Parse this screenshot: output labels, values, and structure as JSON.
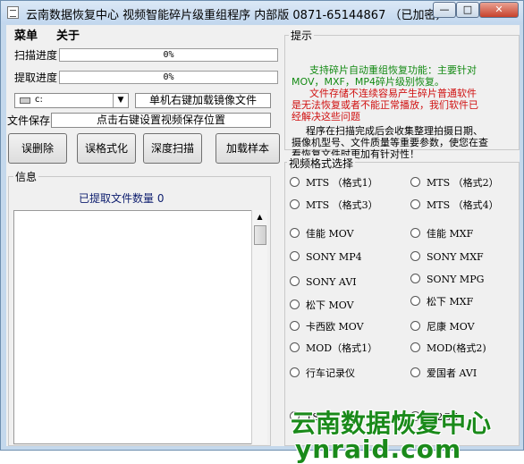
{
  "window": {
    "title": "云南数据恢复中心 视频智能碎片级重组程序 内部版 0871-65144867 （已加密）",
    "controls": {
      "min": "—",
      "max": "□",
      "close": "✕"
    }
  },
  "menu": {
    "items": [
      "菜单",
      "关于"
    ]
  },
  "scan_progress": {
    "label": "扫描进度",
    "value": 0,
    "text": "0%"
  },
  "extract_progress": {
    "label": "提取进度",
    "value": 0,
    "text": "0%"
  },
  "drive_select": {
    "value": "c:"
  },
  "mirror_field": {
    "value": "单机右键加载镜像文件"
  },
  "save_field": {
    "label": "文件保存",
    "value": "点击右键设置视频保存位置"
  },
  "actions": [
    "误删除",
    "误格式化",
    "深度扫描",
    "加载样本"
  ],
  "info": {
    "title": "信息",
    "count_label": "已提取文件数量 0"
  },
  "hint": {
    "title": "提示",
    "line1": "支持碎片自动重组恢复功能：主要针对",
    "line2": "MOV，MXF，MP4碎片级别恢复。",
    "line3": "文件存储不连续容易产生碎片普通软件",
    "line4": "是无法恢复或者不能正常播放，我们软件已",
    "line5": "经解决这些问题",
    "line6": "程序在扫描完成后会收集整理拍摄日期、",
    "line7": "摄像机型号、文件质量等重要参数，使您在查",
    "line8": "看恢复文件时更加有针对性！"
  },
  "formats": {
    "title": "视频格式选择",
    "options": [
      "MTS （格式1）",
      "MTS （格式2）",
      "MTS （格式3）",
      "MTS （格式4）",
      "佳能 MOV",
      "佳能 MXF",
      "SONY MP4",
      "SONY MXF",
      "SONY AVI",
      "SONY MPG",
      "松下 MOV",
      "松下 MXF",
      "卡西欧 MOV",
      "尼康 MOV",
      "MOD（格式1）",
      "MOD(格式2)",
      "行车记录仪",
      "爱国者 AVI",
      "TS",
      "M2GE"
    ]
  },
  "watermark": {
    "name": "云南数据恢复中心",
    "url": "ynraid.com"
  },
  "colors": {
    "hint_green": "#138a13",
    "hint_red": "#d01010",
    "watermark": "#1a8a1a",
    "titlebar": "#c4d8ec"
  }
}
